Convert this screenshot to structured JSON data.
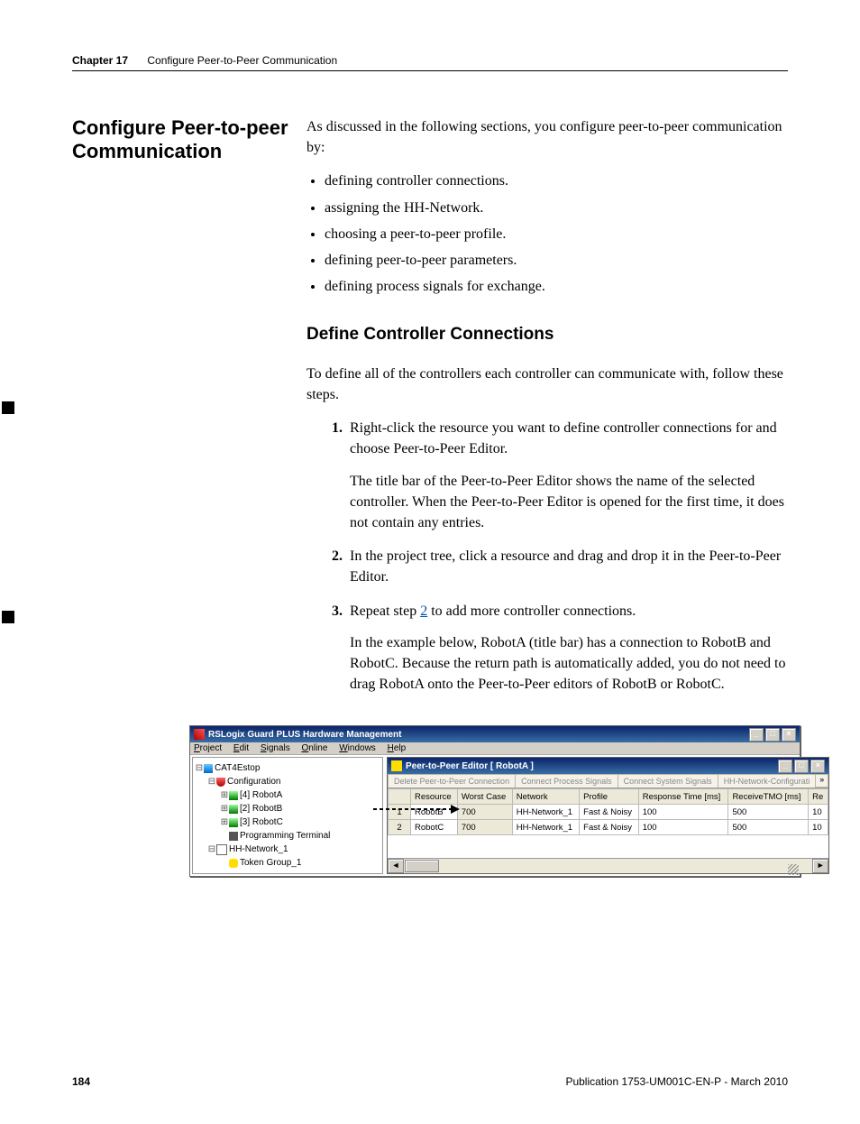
{
  "header": {
    "chapter": "Chapter 17",
    "title": "Configure Peer-to-Peer Communication"
  },
  "section_heading": "Configure Peer-to-peer Communication",
  "intro": "As discussed in the following sections, you configure peer-to-peer communication by:",
  "intro_bullets": [
    "defining controller connections.",
    "assigning the HH-Network.",
    "choosing a peer-to-peer profile.",
    "defining peer-to-peer parameters.",
    "defining process signals for exchange."
  ],
  "sub_heading": "Define Controller Connections",
  "sub_intro": "To define all of the controllers each controller can communicate with, follow these steps.",
  "steps": [
    {
      "text": "Right-click the resource you want to define controller connections for and choose Peer-to-Peer Editor.",
      "extra": "The title bar of the Peer-to-Peer Editor shows the name of the selected controller. When the Peer-to-Peer Editor is opened for the first time, it does not contain any entries."
    },
    {
      "text": "In the project tree, click a resource and drag and drop it in the Peer-to-Peer Editor."
    },
    {
      "text_prefix": "Repeat step ",
      "link": "2",
      "text_suffix": " to add more controller connections.",
      "extra": "In the example below, RobotA (title bar) has a connection to RobotB and RobotC. Because the return path is automatically added, you do not need to drag RobotA onto the Peer-to-Peer editors of RobotB or RobotC."
    }
  ],
  "figure": {
    "app_title": "RSLogix Guard PLUS Hardware Management",
    "menus": [
      "Project",
      "Edit",
      "Signals",
      "Online",
      "Windows",
      "Help"
    ],
    "tree": {
      "root": "CAT4Estop",
      "config": "Configuration",
      "robots": [
        "[4] RobotA",
        "[2] RobotB",
        "[3] RobotC"
      ],
      "prog": "Programming Terminal",
      "net": "HH-Network_1",
      "token": "Token Group_1"
    },
    "child_title": "Peer-to-Peer Editor [ RobotA ]",
    "tabs": [
      "Delete Peer-to-Peer Connection",
      "Connect Process Signals",
      "Connect System Signals",
      "HH-Network-Configurati"
    ],
    "columns": [
      "",
      "Resource",
      "Worst Case",
      "Network",
      "Profile",
      "Response Time [ms]",
      "ReceiveTMO [ms]",
      "Re"
    ],
    "rows": [
      {
        "num": "1",
        "res": "RobotB",
        "wc": "700",
        "net": "HH-Network_1",
        "prof": "Fast & Noisy",
        "rt": "100",
        "rx": "500",
        "re": "10"
      },
      {
        "num": "2",
        "res": "RobotC",
        "wc": "700",
        "net": "HH-Network_1",
        "prof": "Fast & Noisy",
        "rt": "100",
        "rx": "500",
        "re": "10"
      }
    ]
  },
  "footer": {
    "page": "184",
    "pub": "Publication 1753-UM001C-EN-P - March 2010"
  }
}
